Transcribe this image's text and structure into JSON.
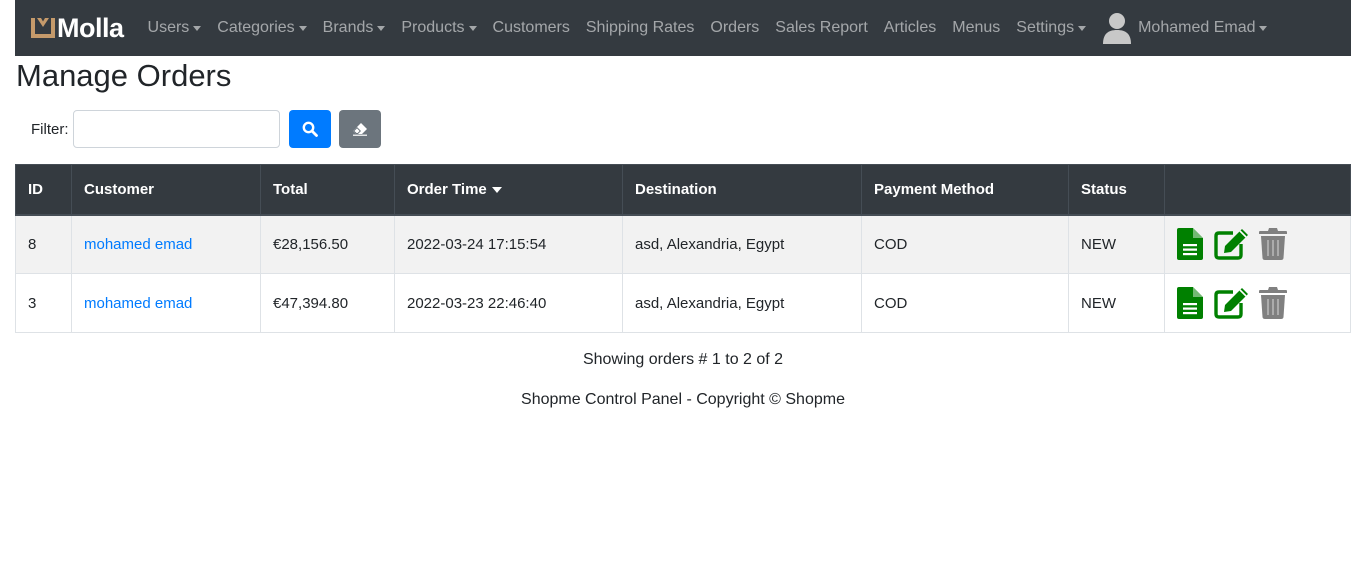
{
  "brand": {
    "name": "Molla",
    "accent_color": "#c59a6b"
  },
  "nav": {
    "items": [
      {
        "label": "Users",
        "dropdown": true
      },
      {
        "label": "Categories",
        "dropdown": true
      },
      {
        "label": "Brands",
        "dropdown": true
      },
      {
        "label": "Products",
        "dropdown": true
      },
      {
        "label": "Customers",
        "dropdown": false
      },
      {
        "label": "Shipping Rates",
        "dropdown": false
      },
      {
        "label": "Orders",
        "dropdown": false
      },
      {
        "label": "Sales Report",
        "dropdown": false
      },
      {
        "label": "Articles",
        "dropdown": false
      },
      {
        "label": "Menus",
        "dropdown": false
      },
      {
        "label": "Settings",
        "dropdown": true
      }
    ],
    "user": {
      "name": "Mohamed Emad",
      "icon": "user-icon"
    }
  },
  "page": {
    "title": "Manage Orders"
  },
  "filter": {
    "label": "Filter:",
    "value": "",
    "placeholder": ""
  },
  "table": {
    "headers": {
      "id": "ID",
      "customer": "Customer",
      "total": "Total",
      "order_time": "Order Time",
      "destination": "Destination",
      "payment_method": "Payment Method",
      "status": "Status",
      "actions": ""
    },
    "rows": [
      {
        "id": "8",
        "customer": "mohamed emad",
        "total": "€28,156.50",
        "order_time": "2022-03-24 17:15:54",
        "destination": "asd, Alexandria, Egypt",
        "payment_method": "COD",
        "status": "NEW"
      },
      {
        "id": "3",
        "customer": "mohamed emad",
        "total": "€47,394.80",
        "order_time": "2022-03-23 22:46:40",
        "destination": "asd, Alexandria, Egypt",
        "payment_method": "COD",
        "status": "NEW"
      }
    ],
    "action_icons": [
      "file-text-icon",
      "edit-icon",
      "trash-icon"
    ],
    "colors": {
      "detail": "#008000",
      "edit": "#008000",
      "delete": "#808080"
    }
  },
  "pagination": {
    "showing_text": "Showing orders # 1 to 2 of 2"
  },
  "footer": {
    "text": "Shopme Control Panel - Copyright © Shopme"
  }
}
